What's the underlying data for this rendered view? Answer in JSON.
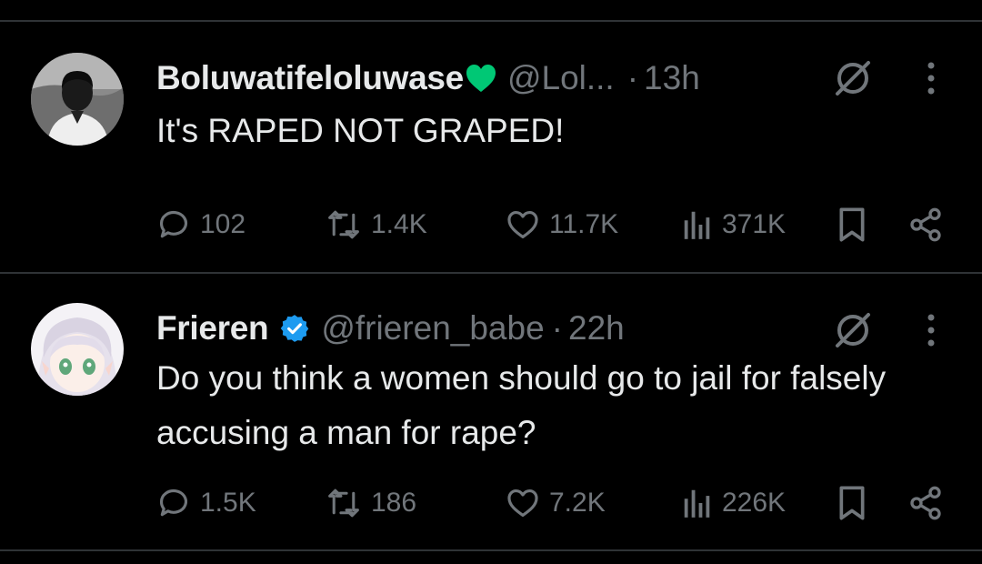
{
  "tweets": [
    {
      "display_name": "Boluwatifeloluwase",
      "name_emoji": "green-heart-icon",
      "handle": "@Lol...",
      "separator": "·",
      "time": "13h",
      "text": "It's RAPED NOT GRAPED!",
      "replies": "102",
      "reposts": "1.4K",
      "likes": "11.7K",
      "views": "371K"
    },
    {
      "display_name": "Frieren",
      "name_badge": "verified-badge-icon",
      "handle": "@frieren_babe",
      "separator": "·",
      "time": "22h",
      "text": "Do you think a women should go to jail for falsely accusing a man for rape?",
      "replies": "1.5K",
      "reposts": "186",
      "likes": "7.2K",
      "views": "226K"
    }
  ],
  "colors": {
    "background": "#000000",
    "text_primary": "#e7e9ea",
    "text_secondary": "#71767b",
    "divider": "#2f3336",
    "verified_blue": "#1d9bf0",
    "heart_green": "#00c875"
  }
}
